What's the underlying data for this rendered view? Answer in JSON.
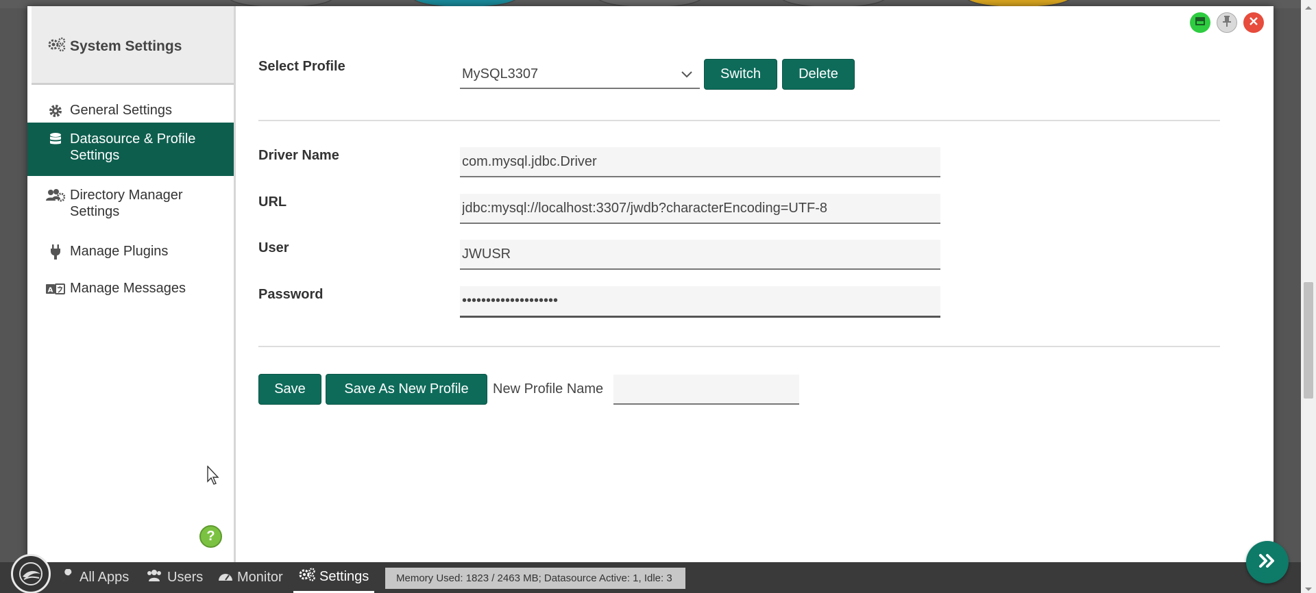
{
  "window": {
    "title": "System Settings"
  },
  "sidebar": {
    "header": "System Settings",
    "items": [
      {
        "label": "General Settings",
        "icon": "gear-icon"
      },
      {
        "label": "Datasource & Profile Settings",
        "icon": "database-icon",
        "active": true
      },
      {
        "label": "Directory Manager Settings",
        "icon": "users-gear-icon"
      },
      {
        "label": "Manage Plugins",
        "icon": "plug-icon"
      },
      {
        "label": "Manage Messages",
        "icon": "language-icon"
      }
    ]
  },
  "profile": {
    "select_label": "Select Profile",
    "selected": "MySQL3307",
    "switch_label": "Switch",
    "delete_label": "Delete"
  },
  "datasource": {
    "driver_label": "Driver Name",
    "driver_value": "com.mysql.jdbc.Driver",
    "url_label": "URL",
    "url_value": "jdbc:mysql://localhost:3307/jwdb?characterEncoding=UTF-8",
    "user_label": "User",
    "user_value": "JWUSR",
    "password_label": "Password",
    "password_value": "••••••••••••••••••••"
  },
  "actions": {
    "save_label": "Save",
    "save_new_label": "Save As New Profile",
    "new_name_label": "New Profile Name",
    "new_name_value": ""
  },
  "taskbar": {
    "items": [
      {
        "label": "All Apps",
        "icon": "wrench-icon"
      },
      {
        "label": "Users",
        "icon": "users-icon"
      },
      {
        "label": "Monitor",
        "icon": "gauge-icon"
      },
      {
        "label": "Settings",
        "icon": "gears-icon",
        "active": true
      }
    ],
    "memory_status": "Memory Used: 1823 / 2463 MB; Datasource Active: 1, Idle: 3"
  },
  "colors": {
    "accent": "#0e6b5a",
    "active_nav": "#0e5e4e",
    "taskbar": "#3a3a3a",
    "help": "#7cc242",
    "close": "#e74c3c",
    "minimize": "#2ecc40"
  }
}
